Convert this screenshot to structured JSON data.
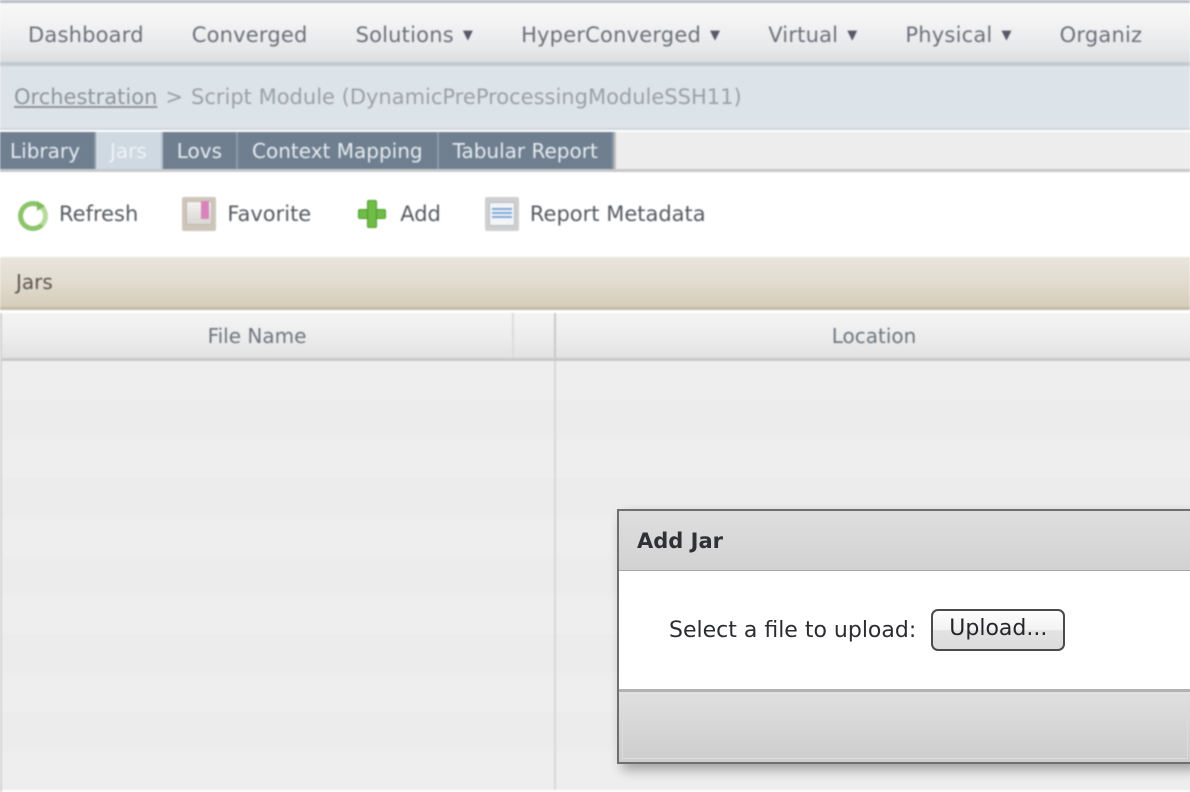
{
  "topnav": {
    "items": [
      {
        "label": "Dashboard",
        "has_caret": false,
        "icon": ""
      },
      {
        "label": "Converged",
        "has_caret": false,
        "icon": ""
      },
      {
        "label": "Solutions",
        "has_caret": true,
        "icon": "chevron-down-icon"
      },
      {
        "label": "HyperConverged",
        "has_caret": true,
        "icon": "chevron-down-icon"
      },
      {
        "label": "Virtual",
        "has_caret": true,
        "icon": "chevron-down-icon"
      },
      {
        "label": "Physical",
        "has_caret": true,
        "icon": "chevron-down-icon"
      },
      {
        "label": "Organiz",
        "has_caret": false,
        "icon": ""
      }
    ],
    "caret_glyph": "▼"
  },
  "breadcrumb": {
    "root": "Orchestration",
    "separator": ">",
    "current": "Script Module (DynamicPreProcessingModuleSSH11)"
  },
  "tabs": [
    {
      "label": "Library",
      "active": false
    },
    {
      "label": "Jars",
      "active": true
    },
    {
      "label": "Lovs",
      "active": false
    },
    {
      "label": "Context Mapping",
      "active": false
    },
    {
      "label": "Tabular Report",
      "active": false
    }
  ],
  "toolbar": [
    {
      "label": "Refresh",
      "icon": "refresh-icon"
    },
    {
      "label": "Favorite",
      "icon": "book-icon"
    },
    {
      "label": "Add",
      "icon": "plus-icon"
    },
    {
      "label": "Report Metadata",
      "icon": "report-icon"
    }
  ],
  "section": {
    "title": "Jars"
  },
  "table": {
    "columns": [
      "File Name",
      "Location"
    ],
    "rows": []
  },
  "dialog": {
    "title": "Add Jar",
    "label": "Select a file to upload:",
    "upload_button": "Upload..."
  },
  "colors": {
    "nav_text": "#6b7079",
    "breadcrumb_bg": "#dde4e9",
    "tab_bg": "#6f7f90",
    "tab_active_bg": "#cfd9e2",
    "section_bg": "#e2ddd1",
    "accent_green": "#6fbd46",
    "dialog_title_bg": "#d8d8d8"
  }
}
